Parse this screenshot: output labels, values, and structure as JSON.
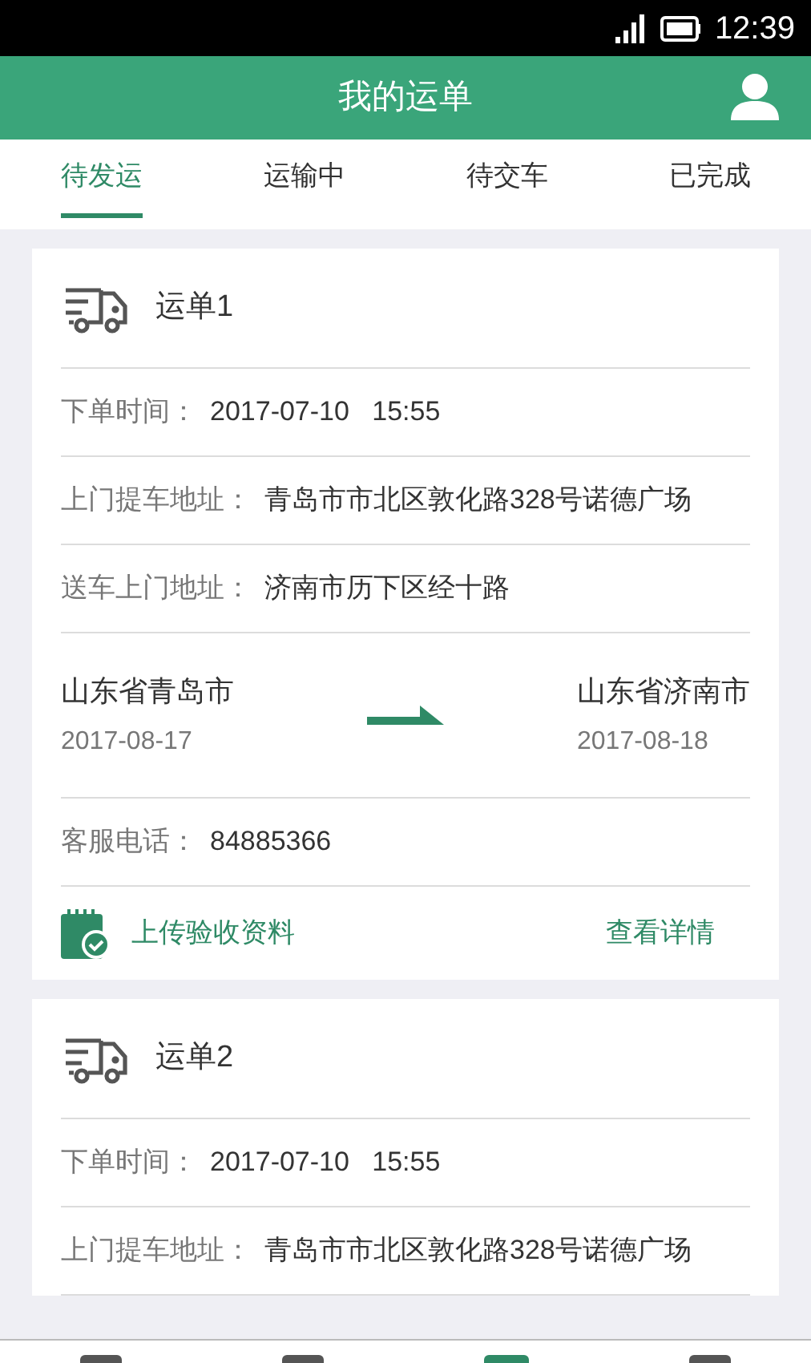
{
  "status_bar": {
    "time": "12:39"
  },
  "header": {
    "title": "我的运单"
  },
  "tabs": [
    {
      "label": "待发运",
      "selected": true
    },
    {
      "label": "运输中",
      "selected": false
    },
    {
      "label": "待交车",
      "selected": false
    },
    {
      "label": "已完成",
      "selected": false
    }
  ],
  "orders": [
    {
      "title": "运单1",
      "fields": [
        {
          "label": "下单时间：",
          "value": "2017-07-10   15:55"
        },
        {
          "label": "上门提车地址：",
          "value": "青岛市市北区敦化路328号诺德广场"
        },
        {
          "label": "送车上门地址：",
          "value": "济南市历下区经十路"
        }
      ],
      "route": {
        "from_city": "山东省青岛市",
        "from_date": "2017-08-17",
        "to_city": "山东省济南市",
        "to_date": "2017-08-18"
      },
      "phone": {
        "label": "客服电话：",
        "value": "84885366"
      },
      "actions": {
        "upload": "上传验收资料",
        "details": "查看详情"
      }
    },
    {
      "title": "运单2",
      "fields": [
        {
          "label": "下单时间：",
          "value": "2017-07-10   15:55"
        },
        {
          "label": "上门提车地址：",
          "value": "青岛市市北区敦化路328号诺德广场"
        }
      ]
    }
  ],
  "bottom_nav": [
    {
      "selected": false
    },
    {
      "selected": false
    },
    {
      "selected": true
    },
    {
      "selected": false
    }
  ]
}
